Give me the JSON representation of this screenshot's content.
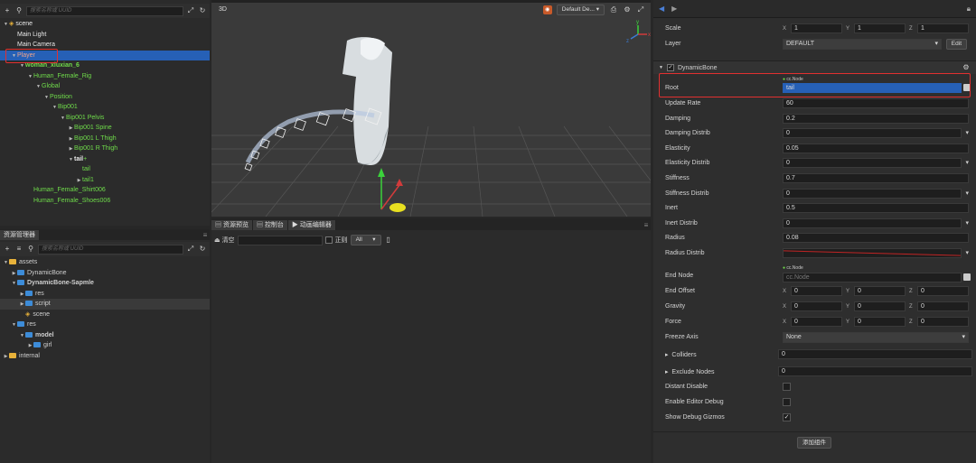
{
  "hierarchy": {
    "search_placeholder": "搜索名称或 UUID",
    "nodes": [
      {
        "label": "scene",
        "depth": 0,
        "arrow": "▼",
        "icon": "scene",
        "color": "white"
      },
      {
        "label": "Main Light",
        "depth": 1,
        "arrow": "",
        "color": "white"
      },
      {
        "label": "Main Camera",
        "depth": 1,
        "arrow": "",
        "color": "white"
      },
      {
        "label": "Player",
        "depth": 1,
        "arrow": "▼",
        "color": "sel"
      },
      {
        "label": "woman_xiuxian_6",
        "depth": 2,
        "arrow": "▼",
        "color": "green",
        "bold": true
      },
      {
        "label": "Human_Female_Rig",
        "depth": 3,
        "arrow": "▼",
        "color": "green"
      },
      {
        "label": "Global",
        "depth": 4,
        "arrow": "▼",
        "color": "green"
      },
      {
        "label": "Position",
        "depth": 5,
        "arrow": "▼",
        "color": "green"
      },
      {
        "label": "Bip001",
        "depth": 6,
        "arrow": "▼",
        "color": "green"
      },
      {
        "label": "Bip001 Pelvis",
        "depth": 7,
        "arrow": "▼",
        "color": "green"
      },
      {
        "label": "Bip001 Spine",
        "depth": 8,
        "arrow": "▶",
        "color": "green"
      },
      {
        "label": "Bip001 L Thigh",
        "depth": 8,
        "arrow": "▶",
        "color": "green"
      },
      {
        "label": "Bip001 R Thigh",
        "depth": 8,
        "arrow": "▶",
        "color": "green"
      },
      {
        "label": "tail",
        "depth": 8,
        "arrow": "▼",
        "color": "white",
        "bold": true
      },
      {
        "label": "tail",
        "depth": 9,
        "arrow": "",
        "color": "green"
      },
      {
        "label": "tail1",
        "depth": 9,
        "arrow": "▶",
        "color": "green"
      },
      {
        "label": "Human_Female_Shirt006",
        "depth": 3,
        "arrow": "",
        "color": "green"
      },
      {
        "label": "Human_Female_Shoes006",
        "depth": 3,
        "arrow": "",
        "color": "green"
      }
    ]
  },
  "assets": {
    "tab": "资源管理器",
    "search_placeholder": "搜索名称或 UUID",
    "nodes": [
      {
        "label": "assets",
        "depth": 0,
        "arrow": "▼",
        "icon": "db"
      },
      {
        "label": "DynamicBone",
        "depth": 1,
        "arrow": "▶",
        "icon": "folder"
      },
      {
        "label": "DynamicBone-Sapmle",
        "depth": 1,
        "arrow": "▼",
        "icon": "folder",
        "bold": true
      },
      {
        "label": "res",
        "depth": 2,
        "arrow": "▶",
        "icon": "folder"
      },
      {
        "label": "script",
        "depth": 2,
        "arrow": "▶",
        "icon": "folder",
        "hl": true
      },
      {
        "label": "scene",
        "depth": 2,
        "arrow": "",
        "icon": "scene"
      },
      {
        "label": "res",
        "depth": 1,
        "arrow": "▼",
        "icon": "folder"
      },
      {
        "label": "model",
        "depth": 2,
        "arrow": "▼",
        "icon": "folder",
        "bold": true
      },
      {
        "label": "girl",
        "depth": 3,
        "arrow": "▶",
        "icon": "folder"
      },
      {
        "label": "internal",
        "depth": 0,
        "arrow": "▶",
        "icon": "db"
      }
    ]
  },
  "scene": {
    "label": "3D",
    "camera": "Default De...",
    "axis_x": "x",
    "axis_y": "y",
    "axis_z": "z"
  },
  "console": {
    "tabs": [
      "资源预览",
      "控制台",
      "动画编辑器"
    ],
    "clear": "清空",
    "regex": "正则",
    "filter": "All"
  },
  "inspector": {
    "scale": {
      "label": "Scale",
      "x": "1",
      "y": "1",
      "z": "1"
    },
    "layer": {
      "label": "Layer",
      "value": "DEFAULT",
      "edit": "Edit"
    },
    "component": "DynamicBone",
    "cc_node": "cc.Node",
    "root": {
      "label": "Root",
      "value": "tail"
    },
    "props": [
      {
        "label": "Update Rate",
        "value": "60"
      },
      {
        "label": "Damping",
        "value": "0.2"
      },
      {
        "label": "Damping Distrib",
        "value": "0",
        "dd": true
      },
      {
        "label": "Elasticity",
        "value": "0.05"
      },
      {
        "label": "Elasticity Distrib",
        "value": "0",
        "dd": true
      },
      {
        "label": "Stiffness",
        "value": "0.7"
      },
      {
        "label": "Stiffness Distrib",
        "value": "0",
        "dd": true
      },
      {
        "label": "Inert",
        "value": "0.5"
      },
      {
        "label": "Inert Distrib",
        "value": "0",
        "dd": true
      },
      {
        "label": "Radius",
        "value": "0.08"
      },
      {
        "label": "Radius Distrib",
        "value": "",
        "dd": true
      }
    ],
    "end_node": {
      "label": "End Node",
      "value": "cc.Node"
    },
    "vectors": [
      {
        "label": "End Offset",
        "x": "0",
        "y": "0",
        "z": "0"
      },
      {
        "label": "Gravity",
        "x": "0",
        "y": "0",
        "z": "0"
      },
      {
        "label": "Force",
        "x": "0",
        "y": "0",
        "z": "0"
      }
    ],
    "freeze": {
      "label": "Freeze Axis",
      "value": "None"
    },
    "colliders": {
      "label": "Colliders",
      "value": "0"
    },
    "exclude": {
      "label": "Exclude Nodes",
      "value": "0"
    },
    "checks": [
      {
        "label": "Distant Disable",
        "checked": false
      },
      {
        "label": "Enable Editor Debug",
        "checked": false
      },
      {
        "label": "Show Debug Gizmos",
        "checked": true
      }
    ],
    "add_component": "添加组件"
  },
  "colors": {
    "accent": "#2660b6",
    "green": "#6fdc4a",
    "red": "#e23030"
  }
}
